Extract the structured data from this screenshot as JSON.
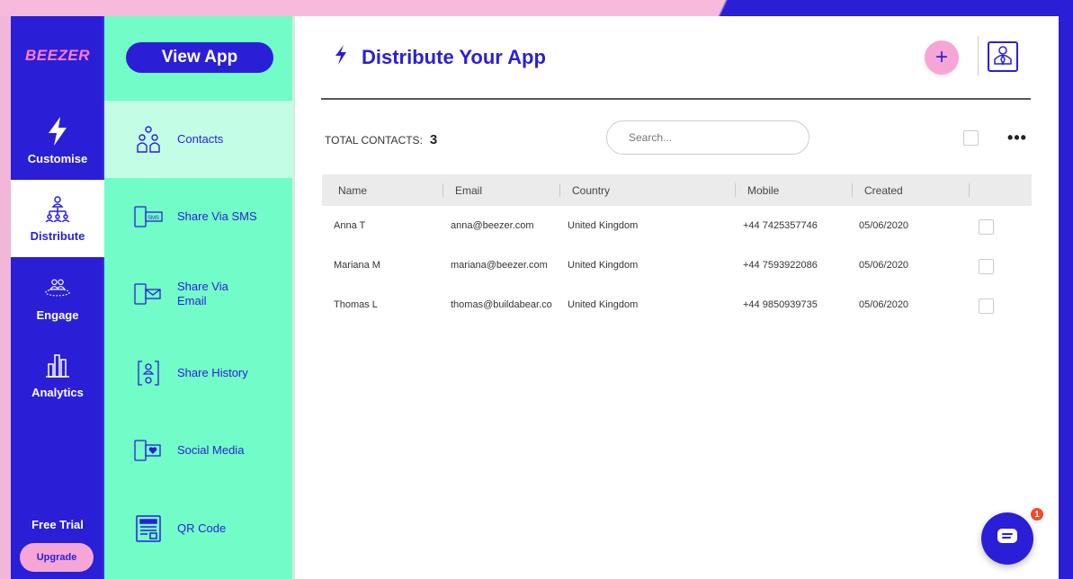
{
  "brand": {
    "logo_text": "BEEZER",
    "primary_color": "#2a1fd6",
    "accent_pink": "#f6a6d6",
    "mint": "#72fcc7"
  },
  "nav": {
    "items": [
      {
        "label": "Customise",
        "icon": "bolt-icon"
      },
      {
        "label": "Distribute",
        "icon": "distribute-network-icon",
        "active": true
      },
      {
        "label": "Engage",
        "icon": "users-group-icon"
      },
      {
        "label": "Analytics",
        "icon": "bar-chart-icon"
      }
    ],
    "free_trial": "Free Trial",
    "upgrade": "Upgrade"
  },
  "subnav": {
    "view_app": "View App",
    "items": [
      {
        "label": "Contacts",
        "icon": "contacts-icon",
        "active": true
      },
      {
        "label": "Share Via SMS",
        "icon": "sms-icon"
      },
      {
        "label": "Share Via Email",
        "icon": "email-icon"
      },
      {
        "label": "Share History",
        "icon": "history-icon"
      },
      {
        "label": "Social Media",
        "icon": "social-heart-icon"
      },
      {
        "label": "QR Code",
        "icon": "qr-code-icon"
      }
    ]
  },
  "header": {
    "title": "Distribute Your App",
    "title_icon": "bolt-icon",
    "add_button": "+",
    "profile_icon": "user-profile-icon"
  },
  "contacts": {
    "total_label": "TOTAL CONTACTS:",
    "total_count": "3",
    "search_placeholder": "Search...",
    "more": "•••",
    "columns": [
      "Name",
      "Email",
      "Country",
      "Mobile",
      "Created"
    ],
    "rows": [
      {
        "name": "Anna T",
        "email": "anna@beezer.com",
        "country": "United Kingdom",
        "mobile": "+44 7425357746",
        "created": "05/06/2020"
      },
      {
        "name": "Mariana M",
        "email": "mariana@beezer.com",
        "country": "United Kingdom",
        "mobile": "+44 7593922086",
        "created": "05/06/2020"
      },
      {
        "name": "Thomas L",
        "email": "thomas@buildabear.co",
        "country": "United Kingdom",
        "mobile": "+44 9850939735",
        "created": "05/06/2020"
      }
    ]
  },
  "chat": {
    "badge": "1",
    "icon": "chat-bubble-icon"
  }
}
